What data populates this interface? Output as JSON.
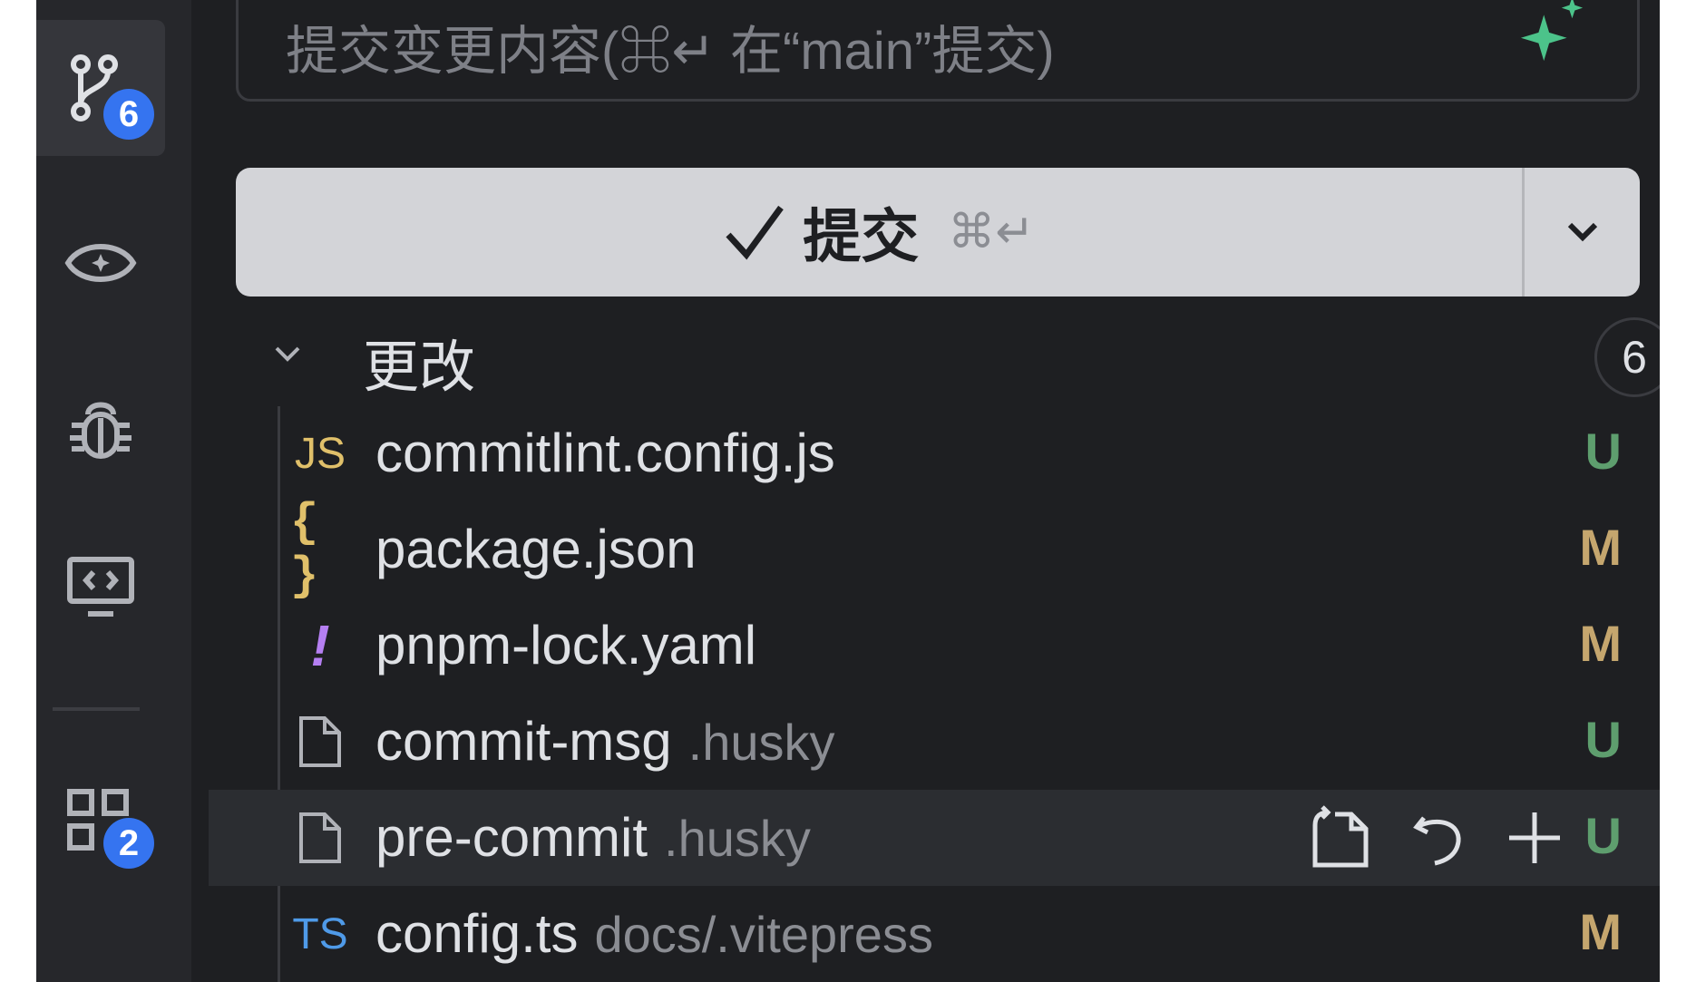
{
  "activity_bar": {
    "source_control_badge": "6",
    "extensions_badge": "2"
  },
  "commit": {
    "message_placeholder": "提交变更内容(⌘↵ 在“main”提交)",
    "button_label": "提交",
    "button_shortcut": "⌘↵"
  },
  "changes": {
    "title": "更改",
    "count": "6",
    "files": [
      {
        "icon": "JS",
        "name": "commitlint.config.js",
        "dir": "",
        "status": "U"
      },
      {
        "icon": "{ }",
        "name": "package.json",
        "dir": "",
        "status": "M"
      },
      {
        "icon": "!",
        "name": "pnpm-lock.yaml",
        "dir": "",
        "status": "M"
      },
      {
        "icon": "file-icon",
        "name": "commit-msg",
        "dir": ".husky",
        "status": "U"
      },
      {
        "icon": "file-icon",
        "name": "pre-commit",
        "dir": ".husky",
        "status": "U"
      },
      {
        "icon": "TS",
        "name": "config.ts",
        "dir": "docs/.vitepress",
        "status": "M"
      }
    ]
  },
  "colors": {
    "accent": "#3574f0",
    "sparkle": "#4cc38a",
    "untracked": "#5e9e6e",
    "modified": "#c5a66e"
  }
}
